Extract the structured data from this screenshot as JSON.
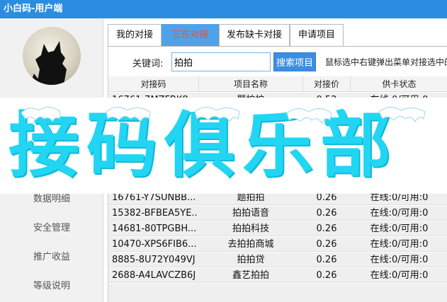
{
  "window": {
    "title": "小白码-用户端"
  },
  "sidebar": {
    "items": [
      {
        "label": "数据明细"
      },
      {
        "label": "安全管理"
      },
      {
        "label": "推广收益"
      },
      {
        "label": "等级说明"
      }
    ]
  },
  "tabs": [
    {
      "label": "我的对接",
      "active": false
    },
    {
      "label": "三东对接",
      "active": true
    },
    {
      "label": "发布缺卡对接",
      "active": false
    },
    {
      "label": "申请项目",
      "active": false
    }
  ],
  "search": {
    "label": "关键词:",
    "value": "拍拍",
    "button_label": "搜索项目",
    "hint": "鼠标选中右键弹出菜单对接选中的"
  },
  "table": {
    "columns": [
      "对接码",
      "项目名称",
      "对接价",
      "供卡状态"
    ],
    "partial_row": [
      "16761-7MZFBK8",
      "题拍拍",
      "0.52",
      "在线:0/可用:0"
    ],
    "rows": [
      [
        "16761-Y7SUNBB...",
        "题拍拍",
        "0.26",
        "在线:0/可用:0"
      ],
      [
        "15382-BFBEA5YE...",
        "拍拍语音",
        "0.26",
        "在线:0/可用:0"
      ],
      [
        "14681-80TPGBH...",
        "拍拍科技",
        "0.26",
        "在线:0/可用:0"
      ],
      [
        "10470-XPS6FIB6...",
        "去拍拍商城",
        "0.26",
        "在线:0/可用:0"
      ],
      [
        "8885-8U72Y049VJ",
        "拍拍贷",
        "0.26",
        "在线:0/可用:0"
      ],
      [
        "2688-A4LAVCZB6J",
        "鑫艺拍拍",
        "0.26",
        "在线:0/可用:0"
      ]
    ]
  },
  "watermark": {
    "text": "接码俱乐部"
  },
  "colors": {
    "titlebar": "#2b8de0",
    "active_tab": "#4fa2ea",
    "active_tab_text": "#e8513a",
    "search_button": "#3c8ee0",
    "watermark": "#22d6f3"
  }
}
